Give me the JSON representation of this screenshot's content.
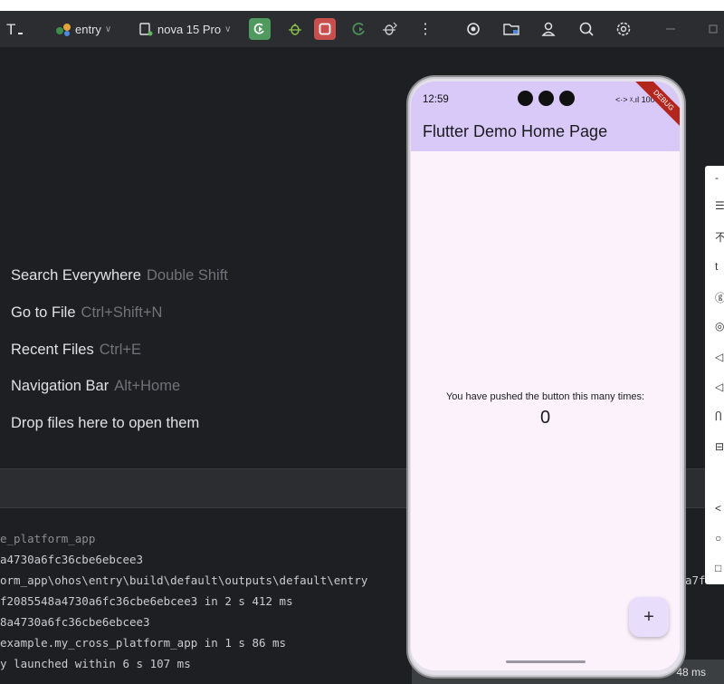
{
  "toolbar": {
    "module": "entry",
    "device": "nova 15 Pro",
    "colors": {
      "run_bg": "#4e9a5f",
      "stop_bg": "#c94f4f"
    }
  },
  "hints": [
    {
      "label": "Search Everywhere",
      "shortcut": "Double Shift"
    },
    {
      "label": "Go to File",
      "shortcut": "Ctrl+Shift+N"
    },
    {
      "label": "Recent Files",
      "shortcut": "Ctrl+E"
    },
    {
      "label": "Navigation Bar",
      "shortcut": "Alt+Home"
    },
    {
      "label": "Drop files here to open them",
      "shortcut": ""
    }
  ],
  "console": {
    "lines": [
      "e_platform_app",
      "a4730a6fc36cbe6ebcee3",
      "orm_app\\ohos\\entry\\build\\default\\outputs\\default\\entry",
      "f2085548a4730a6fc36cbe6ebcee3 in 2 s 412 ms",
      "8a4730a6fc36cbe6ebcee3",
      "example.my_cross_platform_app in 1 s 86 ms",
      "y launched within 6 s 107 ms"
    ],
    "trailing_fragment": "a7f"
  },
  "side_panel": {
    "items": [
      "-",
      "☰",
      "不",
      "t",
      "ⓖ",
      "◎",
      "◁",
      "◁",
      "Ⴖ",
      "⊟",
      "",
      "<",
      "○",
      "□"
    ]
  },
  "bottom_bar": {
    "text": "48 ms"
  },
  "phone": {
    "time": "12:59",
    "status_right": "<·> ᵡ.ıl 100",
    "debug_banner": "DEBUG",
    "app_title": "Flutter Demo Home Page",
    "message": "You have pushed the button this many times:",
    "counter": "0",
    "fab_label": "+"
  }
}
